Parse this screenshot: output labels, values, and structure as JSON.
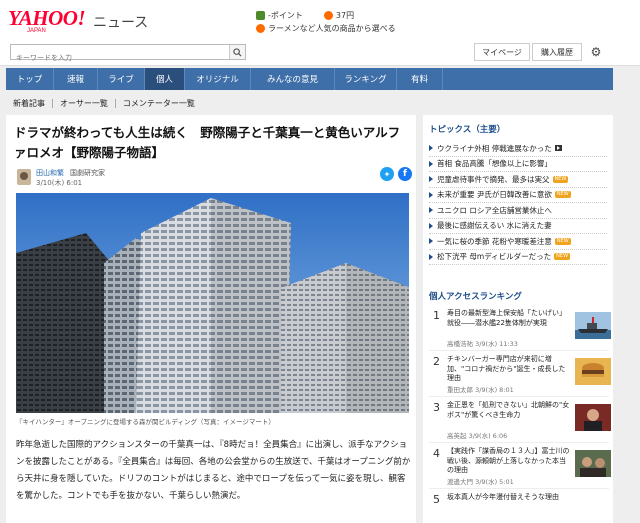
{
  "header": {
    "logo": "YAHOO!",
    "logo_sub": "JAPAN",
    "service": "ニュース",
    "points_label": "-ポイント",
    "points_value": "37円",
    "promo": "ラーメンなど人気の商品から選べる",
    "my_page": "マイページ",
    "purchase_history": "購入履歴"
  },
  "search": {
    "placeholder": "キーワードを入力"
  },
  "nav": {
    "tabs": [
      {
        "label": "トップ"
      },
      {
        "label": "速報"
      },
      {
        "label": "ライブ"
      },
      {
        "label": "個人"
      },
      {
        "label": "オリジナル"
      },
      {
        "label": "みんなの意見"
      },
      {
        "label": "ランキング"
      },
      {
        "label": "有料"
      }
    ],
    "active_index": 3,
    "sub": [
      "新着記事",
      "オーサー一覧",
      "コメンテーター一覧"
    ]
  },
  "article": {
    "title": "ドラマが終わっても人生は続く　野際陽子と千葉真一と黄色いアルファロメオ【野際陽子物語】",
    "author_name": "田山和繁",
    "author_role": "国劇研究家",
    "date": "3/10(木) 6:01",
    "caption": "『キイハンター』オープニングに登場する森が関ビルディング（写真：イメージマート）",
    "body": "昨年急逝した国際的アクションスターの千葉真一は、『8時だョ！全員集合』に出演し、派手なアクションを披露したことがある。『全員集合』は毎回、各地の公会堂からの生放送で、千葉はオープニング前から天井に身を隠していた。ドリフのコントがはじまると、途中でロープを伝って一気に姿を現し、観客を驚かした。コントでも手を抜かない、千葉らしい熱演だ。"
  },
  "topics": {
    "heading": "トピックス（主要）",
    "items": [
      {
        "text": "ウクライナ外相 停戦進展なかった",
        "tag": "video"
      },
      {
        "text": "首相 食品高騰「想像以上に影響」",
        "tag": ""
      },
      {
        "text": "児童虐待事件で摘発、最多は実父",
        "tag": "new"
      },
      {
        "text": "未来が重要 尹氏が日韓改善に意欲",
        "tag": "new"
      },
      {
        "text": "ユニクロ ロシア全店舗営業休止へ",
        "tag": ""
      },
      {
        "text": "最後に感謝伝えるい 水に消えた妻",
        "tag": ""
      },
      {
        "text": "一気に桜の季節 花粉や寒暖差注意",
        "tag": "new"
      },
      {
        "text": "松下洸平 母mディビルダーだった",
        "tag": "new"
      }
    ],
    "new_label": "NEW"
  },
  "ranking": {
    "heading": "個人アクセスランキング",
    "items": [
      {
        "num": "1",
        "title": "寿目の最新型海上保安船「たいげい」就役――潜水艦22隻体制が実現",
        "author": "高橋浩祐",
        "date": "3/9(水) 11:33"
      },
      {
        "num": "2",
        "title": "チキンバーガー専門店が来初に増加、\"コロナ禍だから\"誕生・成長した理由",
        "author": "重田太郎",
        "date": "3/9(水) 8:01"
      },
      {
        "num": "3",
        "title": "金正恩を「処刑できない」北朝鮮の\"女ボス\"が驚くべき生命力",
        "author": "高英起",
        "date": "3/9(水) 6:06"
      },
      {
        "num": "4",
        "title": "【実践作「謀香局の１３人」】富士川の戦い後、源頼朝が上落しなかった本当の理由",
        "author": "渡邊大門",
        "date": "3/9(水) 5:01"
      },
      {
        "num": "5",
        "title": "坂本真人が今年漫付替えそうな理由",
        "author": "",
        "date": ""
      }
    ]
  }
}
